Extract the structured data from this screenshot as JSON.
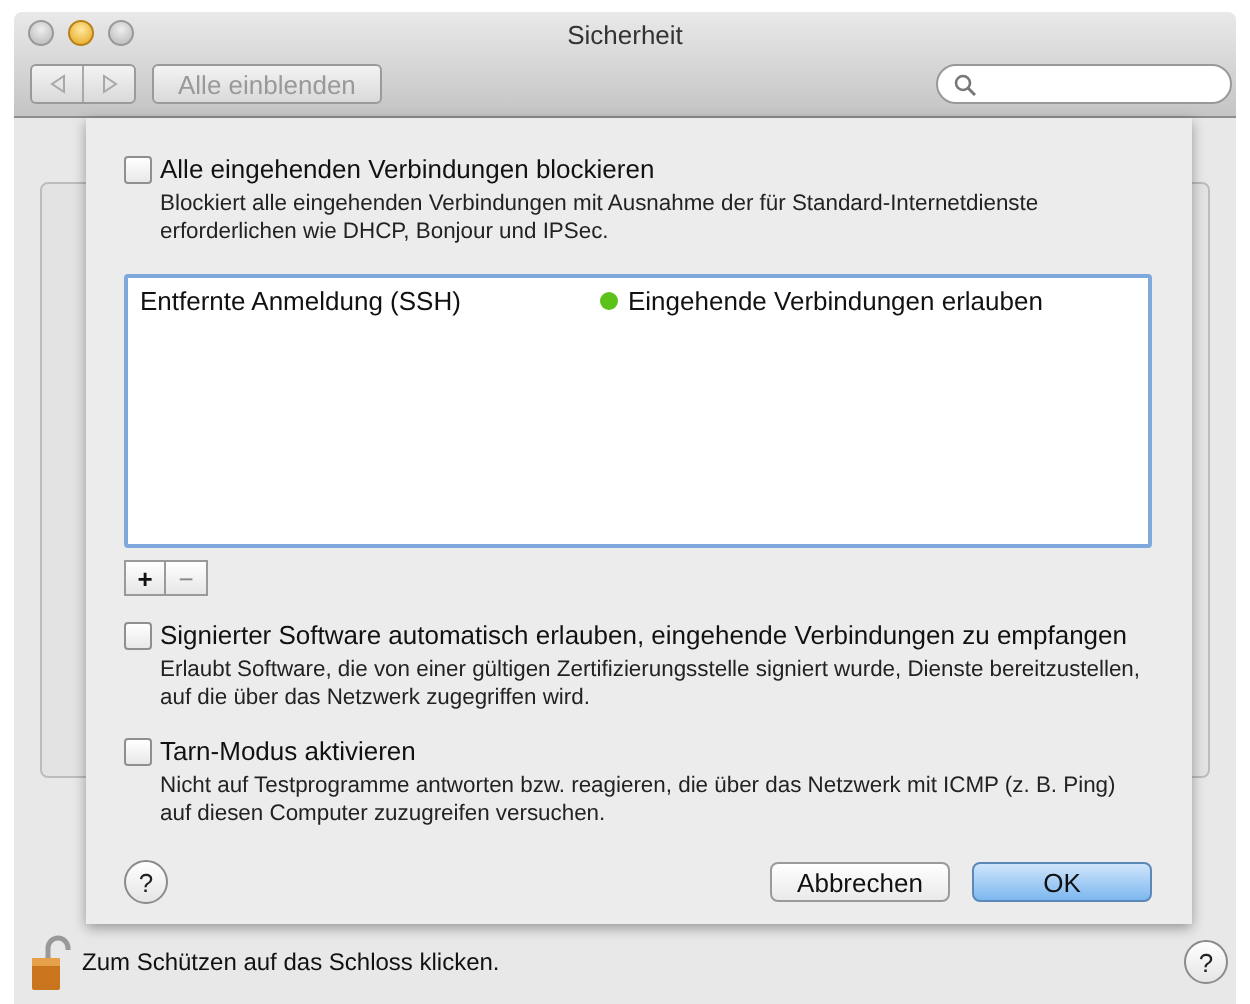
{
  "window": {
    "title": "Sicherheit"
  },
  "toolbar": {
    "show_all": "Alle einblenden"
  },
  "sheet": {
    "options_top": [
      {
        "label": "Alle eingehenden Verbindungen blockieren",
        "description": "Blockiert alle eingehenden Verbindungen mit Ausnahme der für Standard-Internetdienste erforderlichen wie DHCP, Bonjour und IPSec.",
        "checked": false
      }
    ],
    "services": [
      {
        "name": "Entfernte Anmeldung (SSH)",
        "status": "Eingehende Verbindungen erlauben",
        "color": "#5cc21a"
      }
    ],
    "list_buttons": [
      "+",
      "−"
    ],
    "options_bottom": [
      {
        "label": "Signierter Software automatisch erlauben, eingehende Verbindungen zu empfangen",
        "description": "Erlaubt Software, die von einer gültigen Zertifizierungsstelle signiert wurde, Dienste bereitzustellen, auf die über das Netzwerk zugegriffen wird.",
        "checked": false
      },
      {
        "label": "Tarn-Modus aktivieren",
        "description": "Nicht auf Testprogramme antworten bzw. reagieren, die über das Netzwerk mit ICMP (z. B. Ping) auf diesen Computer zuzugreifen versuchen.",
        "checked": false
      }
    ],
    "help": "?",
    "buttons": [
      {
        "label": "Abbrechen",
        "default": false
      },
      {
        "label": "OK",
        "default": true
      }
    ]
  },
  "footer": {
    "lock_text": "Zum Schützen auf das Schloss klicken.",
    "help": "?"
  }
}
